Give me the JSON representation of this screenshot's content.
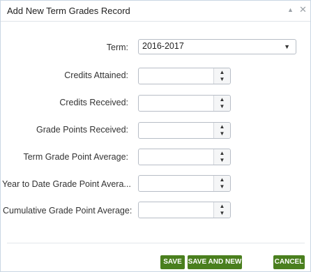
{
  "dialog": {
    "title": "Add New Term Grades Record",
    "collapse_icon": "▲",
    "close_icon": "✕"
  },
  "form": {
    "term": {
      "label": "Term:",
      "value": "2016-2017",
      "caret": "▼"
    },
    "fields": [
      {
        "label": "Credits Attained:",
        "value": ""
      },
      {
        "label": "Credits Received:",
        "value": ""
      },
      {
        "label": "Grade Points Received:",
        "value": ""
      },
      {
        "label": "Term Grade Point Average:",
        "value": ""
      },
      {
        "label": "Year to Date Grade Point Avera...",
        "value": ""
      },
      {
        "label": "Cumulative Grade Point Average:",
        "value": ""
      }
    ],
    "spin_up": "▲",
    "spin_down": "▼"
  },
  "buttons": {
    "save": "SAVE",
    "save_and_new": "SAVE AND NEW",
    "cancel": "CANCEL"
  },
  "colors": {
    "button_bg": "#4a7f1e",
    "border": "#b7bdc6"
  }
}
